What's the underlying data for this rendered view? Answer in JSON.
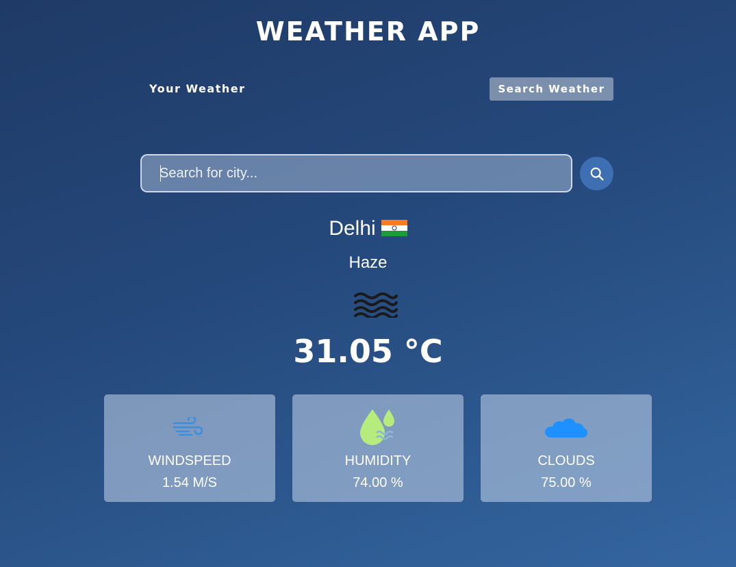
{
  "app": {
    "title": "WEATHER APP"
  },
  "tabs": [
    {
      "label": "Your Weather",
      "active": false
    },
    {
      "label": "Search Weather",
      "active": true
    }
  ],
  "search": {
    "placeholder": "Search for city...",
    "value": "",
    "button_icon": "search-icon"
  },
  "weather": {
    "city": "Delhi",
    "country_flag": "india-flag-icon",
    "condition": "Haze",
    "condition_icon": "haze-icon",
    "temperature": "31.05 °C"
  },
  "stats": [
    {
      "label": "WINDSPEED",
      "value": "1.54 M/S",
      "icon": "wind-icon"
    },
    {
      "label": "HUMIDITY",
      "value": "74.00 %",
      "icon": "humidity-icon"
    },
    {
      "label": "CLOUDS",
      "value": "75.00 %",
      "icon": "cloud-icon"
    }
  ],
  "colors": {
    "background_top": "#1f3a66",
    "background_bottom": "#3565a0",
    "search_button": "#3e6fb2",
    "wind_icon": "#3a8ee0",
    "humidity_icon": "#b6ec7e",
    "cloud_icon": "#1e90ff"
  }
}
